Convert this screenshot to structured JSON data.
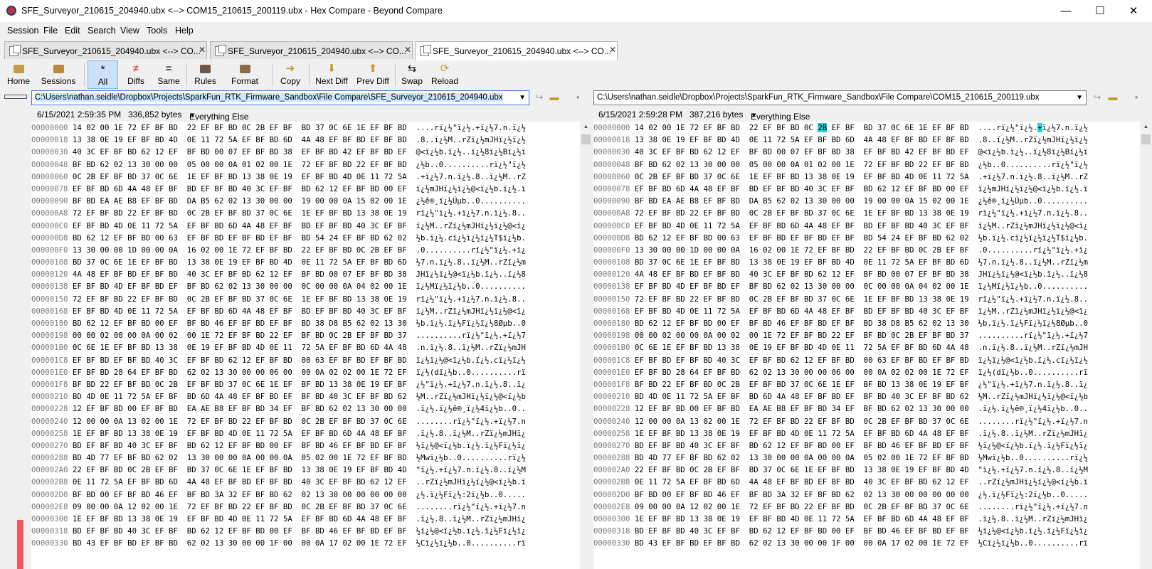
{
  "window": {
    "title": "SFE_Surveyor_210615_204940.ubx <--> COM15_210615_200119.ubx - Hex Compare - Beyond Compare",
    "controls": {
      "minimize": "—",
      "maximize": "☐",
      "close": "✕"
    }
  },
  "menu": [
    "Session",
    "File",
    "Edit",
    "Search",
    "View",
    "Tools",
    "Help"
  ],
  "tabs": [
    {
      "label": "SFE_Surveyor_210615_204940.ubx <--> CO...",
      "active": false
    },
    {
      "label": "SFE_Surveyor_210615_204940.ubx <--> CO...",
      "active": false
    },
    {
      "label": "SFE_Surveyor_210615_204940.ubx <--> CO...",
      "active": true
    }
  ],
  "tab_close": "✕",
  "toolbar": {
    "home": "Home",
    "sessions": "Sessions",
    "all": "All",
    "diffs": "Diffs",
    "same": "Same",
    "rules": "Rules",
    "format": "Format",
    "copy": "Copy",
    "next_diff": "Next Diff",
    "prev_diff": "Prev Diff",
    "swap": "Swap",
    "reload": "Reload",
    "icons": {
      "all": "*",
      "diffs": "≠",
      "same": "="
    }
  },
  "left": {
    "path": "C:\\Users\\nathan.seidle\\Dropbox\\Projects\\SparkFun_RTK_Firmware_Sandbox\\File Compare\\SFE_Surveyor_210615_204940.ubx",
    "date": "6/15/2021 2:59:35 PM",
    "size": "336,852 bytes",
    "format": "Everything Else"
  },
  "right": {
    "path": "C:\\Users\\nathan.seidle\\Dropbox\\Projects\\SparkFun_RTK_Firmware_Sandbox\\File Compare\\COM15_210615_200119.ubx",
    "date": "6/15/2021 2:59:28 PM",
    "size": "387,216 bytes",
    "format": "Everything Else"
  },
  "colors": {
    "diff_highlight": "#24d3e6",
    "accent": "#cce0f7",
    "thumbnail_diff": "#f2565e"
  },
  "hex": {
    "left_rows": [
      [
        "00000000",
        "14 02 00 1E 72 EF BF BD  22 EF BF BD 0C 2B EF BF  BD 37 0C 6E 1E EF BF BD",
        "....rï¿½\"ï¿½.+ï¿½7.n.ï¿½"
      ],
      [
        "00000018",
        "13 38 0E 19 EF BF BD 4D  0E 11 72 5A EF BF BD 6D  4A 48 EF BF BD EF BF BD",
        ".8..ï¿½M..rZï¿½mJHï¿½ï¿½"
      ],
      [
        "00000030",
        "40 3C EF BF BD 62 12 EF  BF BD 00 07 EF BF BD 38  EF BF BD 42 EF BF BD EF",
        "@<ï¿½b.ï¿½..ï¿½8ï¿½Bï¿½ï"
      ],
      [
        "00000048",
        "BF BD 62 02 13 30 00 00  05 00 00 0A 01 02 00 1E  72 EF BF BD 22 EF BF BD",
        "¿½b..0..........rï¿½\"ï¿½"
      ],
      [
        "00000060",
        "0C 2B EF BF BD 37 0C 6E  1E EF BF BD 13 38 0E 19  EF BF BD 4D 0E 11 72 5A",
        ".+ï¿½7.n.ï¿½.8..ï¿½M..rZ"
      ],
      [
        "00000078",
        "EF BF BD 6D 4A 48 EF BF  BD EF BF BD 40 3C EF BF  BD 62 12 EF BF BD 00 EF",
        "ï¿½mJHï¿½ï¿½@<ï¿½b.ï¿½.ï"
      ],
      [
        "00000090",
        "BF BD EA AE B8 EF BF BD  DA B5 62 02 13 30 00 00  19 00 00 0A 15 02 00 1E",
        "¿½ê®¸ï¿½Úµb..0.........."
      ],
      [
        "000000A8",
        "72 EF BF BD 22 EF BF BD  0C 2B EF BF BD 37 0C 6E  1E EF BF BD 13 38 0E 19",
        "rï¿½\"ï¿½.+ï¿½7.n.ï¿½.8.."
      ],
      [
        "000000C0",
        "EF BF BD 4D 0E 11 72 5A  EF BF BD 6D 4A 48 EF BF  BD EF BF BD 40 3C EF BF",
        "ï¿½M..rZï¿½mJHï¿½ï¿½@<ï¿"
      ],
      [
        "000000D8",
        "BD 62 12 EF BF BD 00 63  EF BF BD EF BF BD EF BF  BD 54 24 EF BF BD 62 02",
        "½b.ï¿½.cï¿½ï¿½ï¿½T$ï¿½b."
      ],
      [
        "000000F0",
        "13 30 00 00 1D 00 00 0A  16 02 00 1E 72 EF BF BD  22 EF BF BD 0C 2B EF BF",
        ".0..........rï¿½\"ï¿½.+ï¿"
      ],
      [
        "00000108",
        "BD 37 0C 6E 1E EF BF BD  13 38 0E 19 EF BF BD 4D  0E 11 72 5A EF BF BD 6D",
        "½7.n.ï¿½.8..ï¿½M..rZï¿½m"
      ],
      [
        "00000120",
        "4A 48 EF BF BD EF BF BD  40 3C EF BF BD 62 12 EF  BF BD 00 07 EF BF BD 38",
        "JHï¿½ï¿½@<ï¿½b.ï¿½..ï¿½8"
      ],
      [
        "00000138",
        "EF BF BD 4D EF BF BD EF  BF BD 62 02 13 30 00 00  0C 00 00 0A 04 02 00 1E",
        "ï¿½Mï¿½ï¿½b..0.........."
      ],
      [
        "00000150",
        "72 EF BF BD 22 EF BF BD  0C 2B EF BF BD 37 0C 6E  1E EF BF BD 13 38 0E 19",
        "rï¿½\"ï¿½.+ï¿½7.n.ï¿½.8.."
      ],
      [
        "00000168",
        "EF BF BD 4D 0E 11 72 5A  EF BF BD 6D 4A 48 EF BF  BD EF BF BD 40 3C EF BF",
        "ï¿½M..rZï¿½mJHï¿½ï¿½@<ï¿"
      ],
      [
        "00000180",
        "BD 62 12 EF BF BD 00 EF  BF BD 46 EF BF BD EF BF  BD 38 D8 B5 62 02 13 30",
        "½b.ï¿½.ï¿½Fï¿½ï¿½8Øµb..0"
      ],
      [
        "00000198",
        "00 00 02 00 00 0A 00 02  00 1E 72 EF BF BD 22 EF  BF BD 0C 2B EF BF BD 37",
        "..........rï¿½\"ï¿½.+ï¿½7"
      ],
      [
        "000001B0",
        "0C 6E 1E EF BF BD 13 38  0E 19 EF BF BD 4D 0E 11  72 5A EF BF BD 6D 4A 48",
        ".n.ï¿½.8..ï¿½M..rZï¿½mJH"
      ],
      [
        "000001C8",
        "EF BF BD EF BF BD 40 3C  EF BF BD 62 12 EF BF BD  00 63 EF BF BD EF BF BD",
        "ï¿½ï¿½@<ï¿½b.ï¿½.cï¿½ï¿½"
      ],
      [
        "000001E0",
        "EF BF BD 28 64 EF BF BD  62 02 13 30 00 00 06 00  00 0A 02 02 00 1E 72 EF",
        "ï¿½(dï¿½b..0..........rï"
      ],
      [
        "000001F8",
        "BF BD 22 EF BF BD 0C 2B  EF BF BD 37 0C 6E 1E EF  BF BD 13 38 0E 19 EF BF",
        "¿½\"ï¿½.+ï¿½7.n.ï¿½.8..ï¿"
      ],
      [
        "00000210",
        "BD 4D 0E 11 72 5A EF BF  BD 6D 4A 48 EF BF BD EF  BF BD 40 3C EF BF BD 62",
        "½M..rZï¿½mJHï¿½ï¿½@<ï¿½b"
      ],
      [
        "00000228",
        "12 EF BF BD 00 EF BF BD  EA AE B8 EF BF BD 34 EF  BF BD 62 02 13 30 00 00",
        ".ï¿½.ï¿½ê®¸ï¿½4ï¿½b..0.."
      ],
      [
        "00000240",
        "12 00 00 0A 13 02 00 1E  72 EF BF BD 22 EF BF BD  0C 2B EF BF BD 37 0C 6E",
        "........rï¿½\"ï¿½.+ï¿½7.n"
      ],
      [
        "00000258",
        "1E EF BF BD 13 38 0E 19  EF BF BD 4D 0E 11 72 5A  EF BF BD 6D 4A 48 EF BF",
        ".ï¿½.8..ï¿½M..rZï¿½mJHï¿"
      ],
      [
        "00000270",
        "BD EF BF BD 40 3C EF BF  BD 62 12 EF BF BD 00 EF  BF BD 46 EF BF BD EF BF",
        "½ï¿½@<ï¿½b.ï¿½.ï¿½Fï¿½ï¿"
      ],
      [
        "00000288",
        "BD 4D 77 EF BF BD 62 02  13 30 00 00 0A 00 00 0A  05 02 00 1E 72 EF BF BD",
        "½Mwï¿½b..0..........rï¿½"
      ],
      [
        "000002A0",
        "22 EF BF BD 0C 2B EF BF  BD 37 0C 6E 1E EF BF BD  13 38 0E 19 EF BF BD 4D",
        "\"ï¿½.+ï¿½7.n.ï¿½.8..ï¿½M"
      ],
      [
        "000002B8",
        "0E 11 72 5A EF BF BD 6D  4A 48 EF BF BD EF BF BD  40 3C EF BF BD 62 12 EF",
        "..rZï¿½mJHï¿½ï¿½@<ï¿½b.ï"
      ],
      [
        "000002D0",
        "BF BD 00 EF BF BD 46 EF  BF BD 3A 32 EF BF BD 62  02 13 30 00 00 00 00 00",
        "¿½.ï¿½Fï¿½:2ï¿½b..0....."
      ],
      [
        "000002E8",
        "09 00 00 0A 12 02 00 1E  72 EF BF BD 22 EF BF BD  0C 2B EF BF BD 37 0C 6E",
        "........rï¿½\"ï¿½.+ï¿½7.n"
      ],
      [
        "00000300",
        "1E EF BF BD 13 38 0E 19  EF BF BD 4D 0E 11 72 5A  EF BF BD 6D 4A 48 EF BF",
        ".ï¿½.8..ï¿½M..rZï¿½mJHï¿"
      ],
      [
        "00000318",
        "BD EF BF BD 40 3C EF BF  BD 62 12 EF BF BD 00 EF  BF BD 46 EF BF BD EF BF",
        "½ï¿½@<ï¿½b.ï¿½.ï¿½Fï¿½ï¿"
      ],
      [
        "00000330",
        "BD 43 EF BF BD EF BF BD  62 02 13 30 00 00 1F 00  00 0A 17 02 00 1E 72 EF",
        "½Cï¿½ï¿½b..0..........rï"
      ]
    ],
    "right_rows": [
      [
        "00000000",
        "14 02 00 1E 72 EF BF BD  22 EF BF BD 0C 2B EF BF  BD 37 0C 6E 1E EF BF BD",
        "....rï¿½\"ï¿½.+ï¿½7.n.ï¿½"
      ],
      [
        "00000018",
        "13 38 0E 19 EF BF BD 4D  0E 11 72 5A EF BF BD 6D  4A 48 EF BF BD EF BF BD",
        ".8..ï¿½M..rZï¿½mJHï¿½ï¿½"
      ],
      [
        "00000030",
        "40 3C EF BF BD 62 12 EF  BF BD 00 07 EF BF BD 38  EF BF BD 42 EF BF BD EF",
        "@<ï¿½b.ï¿½..ï¿½8ï¿½Bï¿½ï"
      ],
      [
        "00000048",
        "BF BD 62 02 13 30 00 00  05 00 00 0A 01 02 00 1E  72 EF BF BD 22 EF BF BD",
        "¿½b..0..........rï¿½\"ï¿½"
      ],
      [
        "00000060",
        "0C 2B EF BF BD 37 0C 6E  1E EF BF BD 13 38 0E 19  EF BF BD 4D 0E 11 72 5A",
        ".+ï¿½7.n.ï¿½.8..ï¿½M..rZ"
      ],
      [
        "00000078",
        "EF BF BD 6D 4A 48 EF BF  BD EF BF BD 40 3C EF BF  BD 62 12 EF BF BD 00 EF",
        "ï¿½mJHï¿½ï¿½@<ï¿½b.ï¿½.ï"
      ],
      [
        "00000090",
        "BF BD EA AE B8 EF BF BD  DA B5 62 02 13 30 00 00  19 00 00 0A 15 02 00 1E",
        "¿½ê®¸ï¿½Úµb..0.........."
      ],
      [
        "000000A8",
        "72 EF BF BD 22 EF BF BD  0C 2B EF BF BD 37 0C 6E  1E EF BF BD 13 38 0E 19",
        "rï¿½\"ï¿½.+ï¿½7.n.ï¿½.8.."
      ],
      [
        "000000C0",
        "EF BF BD 4D 0E 11 72 5A  EF BF BD 6D 4A 48 EF BF  BD EF BF BD 40 3C EF BF",
        "ï¿½M..rZï¿½mJHï¿½ï¿½@<ï¿"
      ],
      [
        "000000D8",
        "BD 62 12 EF BF BD 00 63  EF BF BD EF BF BD EF BF  BD 54 24 EF BF BD 62 02",
        "½b.ï¿½.cï¿½ï¿½ï¿½T$ï¿½b."
      ],
      [
        "000000F0",
        "13 30 00 00 1D 00 00 0A  16 02 00 1E 72 EF BF BD  22 EF BF BD 0C 2B EF BF",
        ".0..........rï¿½\"ï¿½.+ï¿"
      ],
      [
        "00000108",
        "BD 37 0C 6E 1E EF BF BD  13 38 0E 19 EF BF BD 4D  0E 11 72 5A EF BF BD 6D",
        "½7.n.ï¿½.8..ï¿½M..rZï¿½m"
      ],
      [
        "00000120",
        "4A 48 EF BF BD EF BF BD  40 3C EF BF BD 62 12 EF  BF BD 00 07 EF BF BD 38",
        "JHï¿½ï¿½@<ï¿½b.ï¿½..ï¿½8"
      ],
      [
        "00000138",
        "EF BF BD 4D EF BF BD EF  BF BD 62 02 13 30 00 00  0C 00 00 0A 04 02 00 1E",
        "ï¿½Mï¿½ï¿½b..0.........."
      ],
      [
        "00000150",
        "72 EF BF BD 22 EF BF BD  0C 2B EF BF BD 37 0C 6E  1E EF BF BD 13 38 0E 19",
        "rï¿½\"ï¿½.+ï¿½7.n.ï¿½.8.."
      ],
      [
        "00000168",
        "EF BF BD 4D 0E 11 72 5A  EF BF BD 6D 4A 48 EF BF  BD EF BF BD 40 3C EF BF",
        "ï¿½M..rZï¿½mJHï¿½ï¿½@<ï¿"
      ],
      [
        "00000180",
        "BD 62 12 EF BF BD 00 EF  BF BD 46 EF BF BD EF BF  BD 38 D8 B5 62 02 13 30",
        "½b.ï¿½.ï¿½Fï¿½ï¿½8Øµb..0"
      ],
      [
        "00000198",
        "00 00 02 00 00 0A 00 02  00 1E 72 EF BF BD 22 EF  BF BD 0C 2B EF BF BD 37",
        "..........rï¿½\"ï¿½.+ï¿½7"
      ],
      [
        "000001B0",
        "0C 6E 1E EF BF BD 13 38  0E 19 EF BF BD 4D 0E 11  72 5A EF BF BD 6D 4A 48",
        ".n.ï¿½.8..ï¿½M..rZï¿½mJH"
      ],
      [
        "000001C8",
        "EF BF BD EF BF BD 40 3C  EF BF BD 62 12 EF BF BD  00 63 EF BF BD EF BF BD",
        "ï¿½ï¿½@<ï¿½b.ï¿½.cï¿½ï¿½"
      ],
      [
        "000001E0",
        "EF BF BD 28 64 EF BF BD  62 02 13 30 00 00 06 00  00 0A 02 02 00 1E 72 EF",
        "ï¿½(dï¿½b..0..........rï"
      ],
      [
        "000001F8",
        "BF BD 22 EF BF BD 0C 2B  EF BF BD 37 0C 6E 1E EF  BF BD 13 38 0E 19 EF BF",
        "¿½\"ï¿½.+ï¿½7.n.ï¿½.8..ï¿"
      ],
      [
        "00000210",
        "BD 4D 0E 11 72 5A EF BF  BD 6D 4A 48 EF BF BD EF  BF BD 40 3C EF BF BD 62",
        "½M..rZï¿½mJHï¿½ï¿½@<ï¿½b"
      ],
      [
        "00000228",
        "12 EF BF BD 00 EF BF BD  EA AE B8 EF BF BD 34 EF  BF BD 62 02 13 30 00 00",
        ".ï¿½.ï¿½ê®¸ï¿½4ï¿½b..0.."
      ],
      [
        "00000240",
        "12 00 00 0A 13 02 00 1E  72 EF BF BD 22 EF BF BD  0C 2B EF BF BD 37 0C 6E",
        "........rï¿½\"ï¿½.+ï¿½7.n"
      ],
      [
        "00000258",
        "1E EF BF BD 13 38 0E 19  EF BF BD 4D 0E 11 72 5A  EF BF BD 6D 4A 48 EF BF",
        ".ï¿½.8..ï¿½M..rZï¿½mJHï¿"
      ],
      [
        "00000270",
        "BD EF BF BD 40 3C EF BF  BD 62 12 EF BF BD 00 EF  BF BD 46 EF BF BD EF BF",
        "½ï¿½@<ï¿½b.ï¿½.ï¿½Fï¿½ï¿"
      ],
      [
        "00000288",
        "BD 4D 77 EF BF BD 62 02  13 30 00 00 0A 00 00 0A  05 02 00 1E 72 EF BF BD",
        "½Mwï¿½b..0..........rï¿½"
      ],
      [
        "000002A0",
        "22 EF BF BD 0C 2B EF BF  BD 37 0C 6E 1E EF BF BD  13 38 0E 19 EF BF BD 4D",
        "\"ï¿½.+ï¿½7.n.ï¿½.8..ï¿½M"
      ],
      [
        "000002B8",
        "0E 11 72 5A EF BF BD 6D  4A 48 EF BF BD EF BF BD  40 3C EF BF BD 62 12 EF",
        "..rZï¿½mJHï¿½ï¿½@<ï¿½b.ï"
      ],
      [
        "000002D0",
        "BF BD 00 EF BF BD 46 EF  BF BD 3A 32 EF BF BD 62  02 13 30 00 00 00 00 00",
        "¿½.ï¿½Fï¿½:2ï¿½b..0....."
      ],
      [
        "000002E8",
        "09 00 00 0A 12 02 00 1E  72 EF BF BD 22 EF BF BD  0C 2B EF BF BD 37 0C 6E",
        "........rï¿½\"ï¿½.+ï¿½7.n"
      ],
      [
        "00000300",
        "1E EF BF BD 13 38 0E 19  EF BF BD 4D 0E 11 72 5A  EF BF BD 6D 4A 48 EF BF",
        ".ï¿½.8..ï¿½M..rZï¿½mJHï¿"
      ],
      [
        "00000318",
        "BD EF BF BD 40 3C EF BF  BD 62 12 EF BF BD 00 EF  BF BD 46 EF BF BD EF BF",
        "½ï¿½@<ï¿½b.ï¿½.ï¿½Fï¿½ï¿"
      ],
      [
        "00000330",
        "BD 43 EF BF BD EF BF BD  62 02 13 30 00 00 1F 00  00 0A 17 02 00 1E 72 EF",
        "½Cï¿½ï¿½b..0..........rï"
      ]
    ]
  }
}
